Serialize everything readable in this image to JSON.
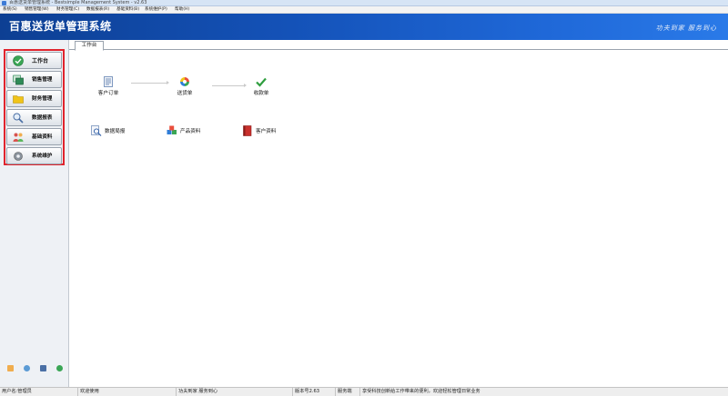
{
  "window": {
    "title": "百惠送货单管理系统 - Bestsimple Management System - v2.63"
  },
  "menu": [
    {
      "label": "系统(S)"
    },
    {
      "label": "销售管理(W)"
    },
    {
      "label": "财务管理(C)"
    },
    {
      "label": "数据报表(R)"
    },
    {
      "label": "基础资料(B)"
    },
    {
      "label": "系统维护(P)"
    },
    {
      "label": "帮助(H)"
    }
  ],
  "banner": {
    "title": "百惠送货单管理系统",
    "slogan": "功夫到家 服务到心"
  },
  "sidebar": {
    "items": [
      {
        "label": "工作台",
        "icon": "check-circle-icon",
        "color": "#3aa655"
      },
      {
        "label": "销售管理",
        "icon": "window-stack-icon",
        "color": "#2e8b57"
      },
      {
        "label": "财务管理",
        "icon": "folder-icon",
        "color": "#f0c419"
      },
      {
        "label": "数据报表",
        "icon": "magnifier-icon",
        "color": "#4a6fa5"
      },
      {
        "label": "基础资料",
        "icon": "people-icon",
        "color": "#d9534f"
      },
      {
        "label": "系统维护",
        "icon": "gear-icon",
        "color": "#6c757d"
      }
    ],
    "highlight_color": "#e0242d"
  },
  "tabs": [
    {
      "label": "工作台"
    }
  ],
  "workflow": [
    {
      "label": "客户订单",
      "icon": "order-form-icon"
    },
    {
      "label": "送货单",
      "icon": "delivery-swirl-icon"
    },
    {
      "label": "收款单",
      "icon": "green-check-icon"
    }
  ],
  "quick_links": [
    {
      "label": "数据局报",
      "icon": "report-magnifier-icon"
    },
    {
      "label": "产品资料",
      "icon": "products-cubes-icon"
    },
    {
      "label": "客户资料",
      "icon": "red-book-icon"
    }
  ],
  "status": {
    "user": "用户名:管理员",
    "welcome": "欢迎使用",
    "motto": "功夫到家 服务到心",
    "version": "版本号2.63",
    "service": "服务端",
    "message": "享受科技创新给工作带来的便利，欢迎轻松管理日常业务"
  }
}
